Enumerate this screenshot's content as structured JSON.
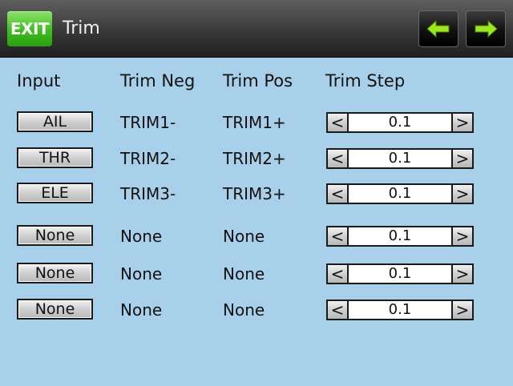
{
  "titlebar": {
    "exit_label": "EXIT",
    "title": "Trim",
    "back_icon": "arrow-left-icon",
    "forward_icon": "arrow-right-icon",
    "accent_green": "#3dbd1f",
    "arrow_color": "#9be81e"
  },
  "columns": {
    "input": "Input",
    "trim_neg": "Trim Neg",
    "trim_pos": "Trim Pos",
    "trim_step": "Trim Step"
  },
  "rows": [
    {
      "input": "AIL",
      "neg": "TRIM1-",
      "pos": "TRIM1+",
      "dec": "<",
      "step": "0.1",
      "inc": ">"
    },
    {
      "input": "THR",
      "neg": "TRIM2-",
      "pos": "TRIM2+",
      "dec": "<",
      "step": "0.1",
      "inc": ">"
    },
    {
      "input": "ELE",
      "neg": "TRIM3-",
      "pos": "TRIM3+",
      "dec": "<",
      "step": "0.1",
      "inc": ">"
    },
    {
      "input": "None",
      "neg": "None",
      "pos": "None",
      "dec": "<",
      "step": "0.1",
      "inc": ">"
    },
    {
      "input": "None",
      "neg": "None",
      "pos": "None",
      "dec": "<",
      "step": "0.1",
      "inc": ">"
    },
    {
      "input": "None",
      "neg": "None",
      "pos": "None",
      "dec": "<",
      "step": "0.1",
      "inc": ">"
    }
  ],
  "colors": {
    "background": "#a9d0ea",
    "titlebar": "#3c3c3c"
  }
}
